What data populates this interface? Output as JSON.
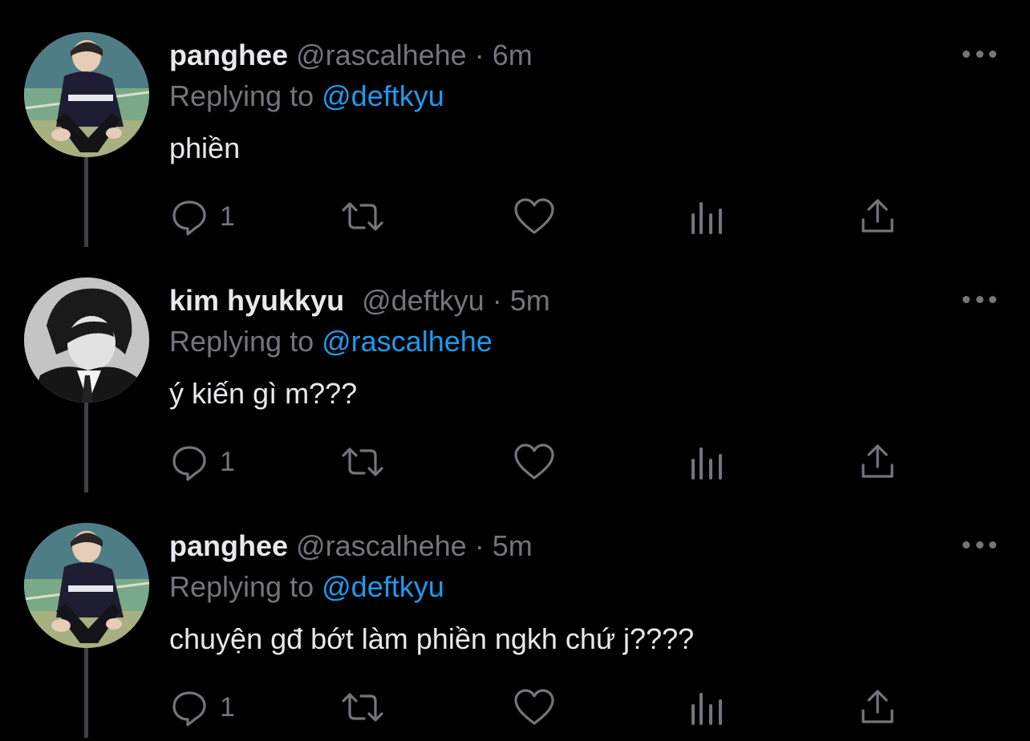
{
  "tweets": [
    {
      "display_name": "panghee",
      "handle": "@rascalhehe",
      "separator": "·",
      "time": "6m",
      "replying_prefix": "Replying to",
      "replying_to": "@deftkyu",
      "text": "phiền",
      "reply_count": "1",
      "avatar_icon": "avatar-photo-color"
    },
    {
      "display_name": "kim hyukkyu",
      "handle": "@deftkyu",
      "separator": "·",
      "time": "5m",
      "replying_prefix": "Replying to",
      "replying_to": "@rascalhehe",
      "text": "ý kiến gì m???",
      "reply_count": "1",
      "avatar_icon": "avatar-photo-monochrome"
    },
    {
      "display_name": "panghee",
      "handle": "@rascalhehe",
      "separator": "·",
      "time": "5m",
      "replying_prefix": "Replying to",
      "replying_to": "@deftkyu",
      "text": "chuyện gđ bớt làm phiền ngkh chứ j????",
      "reply_count": "1",
      "avatar_icon": "avatar-photo-color"
    }
  ],
  "icons": {
    "more": "more-horizontal-icon",
    "reply": "reply-bubble-icon",
    "retweet": "retweet-icon",
    "like": "heart-icon",
    "views": "views-bars-icon",
    "share": "share-upload-icon"
  },
  "colors": {
    "background": "#000000",
    "primary_text": "#e7e9ea",
    "secondary_text": "#71767b",
    "accent": "#1d9bf0",
    "thread_line": "#3e4144"
  }
}
